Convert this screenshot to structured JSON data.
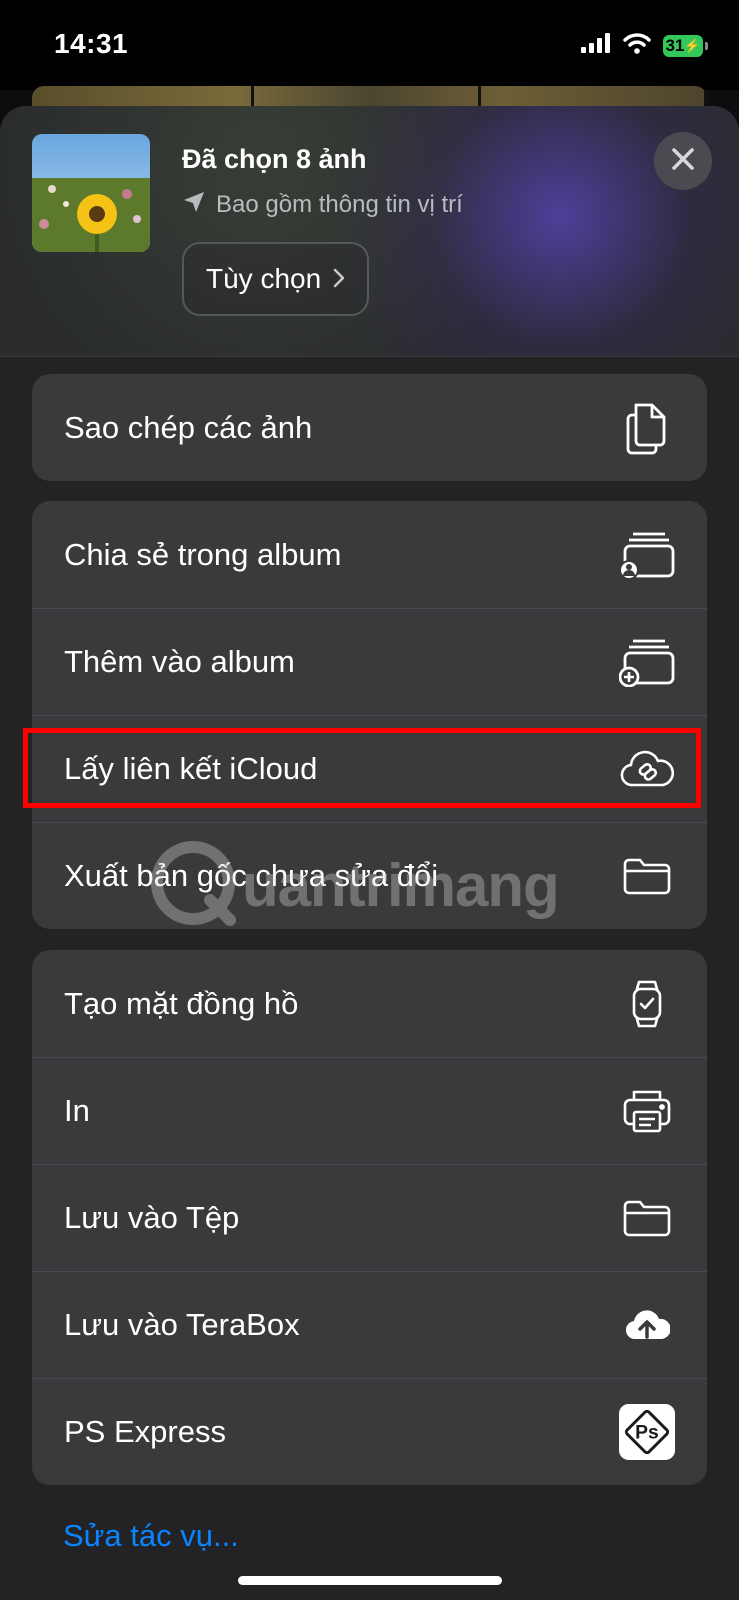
{
  "status_bar": {
    "time": "14:31",
    "battery": "31"
  },
  "header": {
    "title": "Đã chọn 8 ảnh",
    "subtitle": "Bao gồm thông tin vị trí",
    "options_label": "Tùy chọn"
  },
  "groups": [
    {
      "items": [
        {
          "label": "Sao chép các ảnh",
          "icon": "copy-icon"
        }
      ]
    },
    {
      "items": [
        {
          "label": "Chia sẻ trong album",
          "icon": "shared-album-icon"
        },
        {
          "label": "Thêm vào album",
          "icon": "add-to-album-icon"
        },
        {
          "label": "Lấy liên kết iCloud",
          "icon": "icloud-link-icon"
        },
        {
          "label": "Xuất bản gốc chưa sửa đổi",
          "icon": "folder-icon"
        }
      ]
    },
    {
      "items": [
        {
          "label": "Tạo mặt đồng hồ",
          "icon": "watch-icon"
        },
        {
          "label": "In",
          "icon": "printer-icon"
        },
        {
          "label": "Lưu vào Tệp",
          "icon": "folder-icon"
        },
        {
          "label": "Lưu vào TeraBox",
          "icon": "cloud-upload-icon"
        },
        {
          "label": "PS Express",
          "icon": "ps-express-icon"
        }
      ]
    }
  ],
  "footer": {
    "edit_actions": "Sửa tác vụ..."
  },
  "watermark": {
    "text": "uantrimang"
  },
  "colors": {
    "accent": "#0a84ff",
    "highlight": "#ff0000",
    "row_bg": "#3a3a3c",
    "sheet_bg": "#232326"
  }
}
